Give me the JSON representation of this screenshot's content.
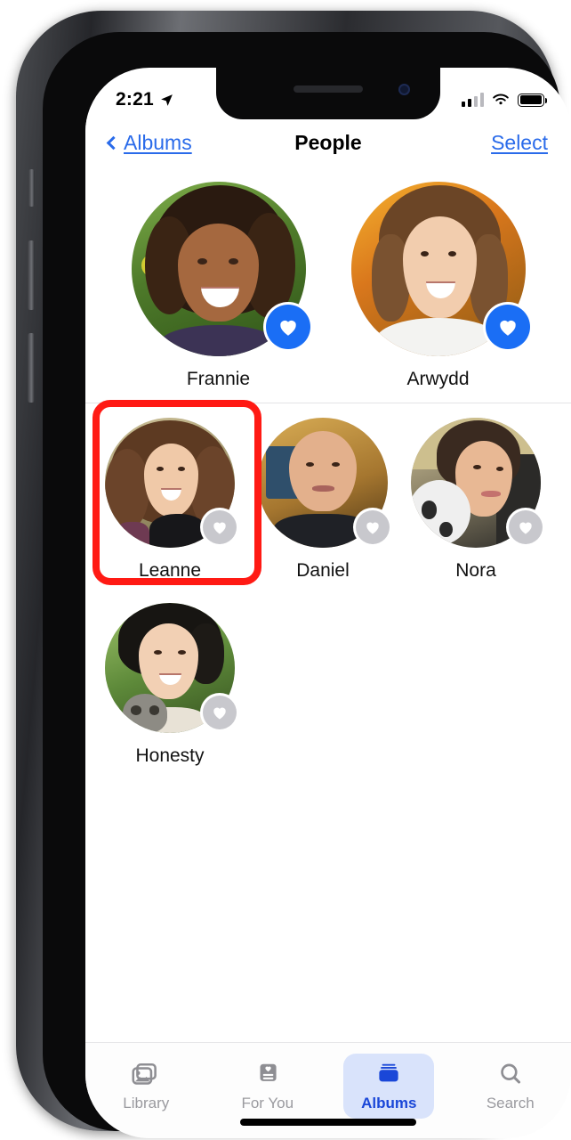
{
  "status_bar": {
    "time": "2:21",
    "location_icon": "location-arrow-icon",
    "cellular_icon": "cellular-signal-icon",
    "wifi_icon": "wifi-icon",
    "battery_icon": "battery-icon"
  },
  "nav": {
    "back_label": "Albums",
    "back_icon": "chevron-left-icon",
    "title": "People",
    "action_label": "Select"
  },
  "favorites": [
    {
      "name": "Frannie",
      "favorited": true,
      "badge_icon": "heart-icon"
    },
    {
      "name": "Arwydd",
      "favorited": true,
      "badge_icon": "heart-icon"
    }
  ],
  "people": [
    {
      "name": "Leanne",
      "favorited": false,
      "badge_icon": "heart-icon",
      "highlighted": true
    },
    {
      "name": "Daniel",
      "favorited": false,
      "badge_icon": "heart-icon",
      "highlighted": false
    },
    {
      "name": "Nora",
      "favorited": false,
      "badge_icon": "heart-icon",
      "highlighted": false
    },
    {
      "name": "Honesty",
      "favorited": false,
      "badge_icon": "heart-icon",
      "highlighted": false
    }
  ],
  "tabs": [
    {
      "label": "Library",
      "icon": "photos-library-icon",
      "selected": false
    },
    {
      "label": "For You",
      "icon": "for-you-card-icon",
      "selected": false
    },
    {
      "label": "Albums",
      "icon": "albums-book-icon",
      "selected": true
    },
    {
      "label": "Search",
      "icon": "search-icon",
      "selected": false
    }
  ],
  "colors": {
    "accent_blue": "#2a6bea",
    "favorite_badge": "#1a6ef5",
    "unfavorite_badge": "#c8c8cd",
    "tab_selected_pill": "#d9e3fb",
    "tab_selected_text": "#1a47d8",
    "annotation_red": "#ff1a14"
  }
}
